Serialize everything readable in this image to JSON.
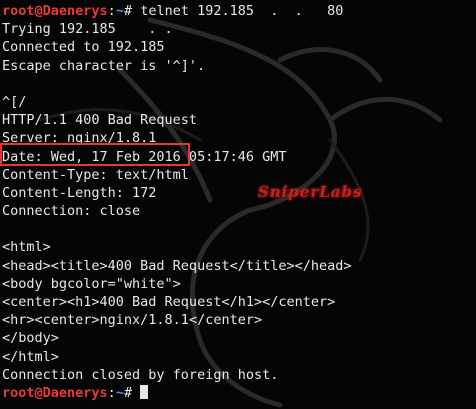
{
  "terminal": {
    "prompt_user": "root@Daenerys",
    "prompt_path": "~",
    "prompt_sep": ":",
    "prompt_symbol": "#",
    "command": " telnet 192.185  .  .   80",
    "output": [
      "Trying 192.185    . .",
      "Connected to 192.185",
      "Escape character is '^]'.",
      "",
      "^[/",
      "HTTP/1.1 400 Bad Request",
      "Server: nginx/1.8.1",
      "Date: Wed, 17 Feb 2016 05:17:46 GMT",
      "Content-Type: text/html",
      "Content-Length: 172",
      "Connection: close",
      "",
      "<html>",
      "<head><title>400 Bad Request</title></head>",
      "<body bgcolor=\"white\">",
      "<center><h1>400 Bad Request</h1></center>",
      "<hr><center>nginx/1.8.1</center>",
      "</body>",
      "</html>",
      "Connection closed by foreign host."
    ]
  },
  "watermark": {
    "text": "SniperLabs",
    "color": "#c32222"
  },
  "colors": {
    "background": "#050505",
    "text": "#e8e8e8",
    "prompt_user": "#e83a3a",
    "prompt_path": "#5a8fe0",
    "highlight": "#e23b2e"
  }
}
